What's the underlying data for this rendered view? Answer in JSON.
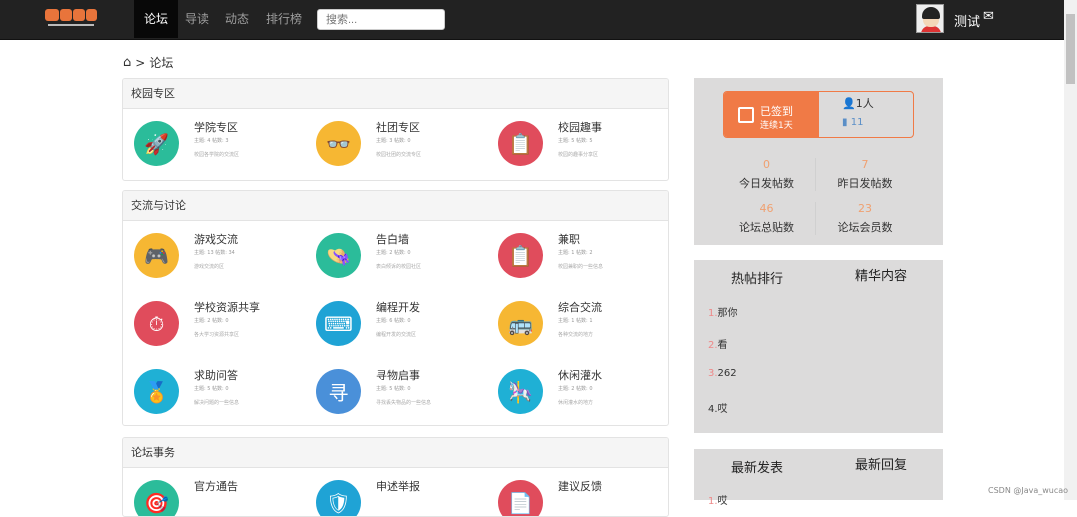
{
  "nav": {
    "items": [
      "论坛",
      "导读",
      "动态",
      "排行榜"
    ],
    "active": 0,
    "search_placeholder": "搜索...",
    "username": "测试"
  },
  "breadcrumb": {
    "current": "论坛"
  },
  "sections": [
    {
      "title": "校园专区",
      "items": [
        {
          "name": "学院专区",
          "meta": "主题: 4  帖数: 3",
          "desc": "校园各学院的交流区",
          "icon": "rocket-icon",
          "color": "#2bbc9a",
          "glyph": "🚀"
        },
        {
          "name": "社团专区",
          "meta": "主题: 3  帖数: 0",
          "desc": "校园社团的交流专区",
          "icon": "glasses-icon",
          "color": "#f6b733",
          "glyph": "👓"
        },
        {
          "name": "校园趣事",
          "meta": "主题: 5  帖数: 5",
          "desc": "校园的趣事分享区",
          "icon": "checklist-icon",
          "color": "#e04c5c",
          "glyph": "📋"
        }
      ]
    },
    {
      "title": "交流与讨论",
      "items": [
        {
          "name": "游戏交流",
          "meta": "主题: 13  帖数: 34",
          "desc": "游戏交流的区",
          "icon": "gamepad-icon",
          "color": "#f6b733",
          "glyph": "🎮"
        },
        {
          "name": "告白墙",
          "meta": "主题: 2  帖数: 0",
          "desc": "表白倾诉的校园社区",
          "icon": "hat-icon",
          "color": "#2bbc9a",
          "glyph": "👒"
        },
        {
          "name": "兼职",
          "meta": "主题: 1  帖数: 2",
          "desc": "校园兼职的一些信息",
          "icon": "clipboard-icon",
          "color": "#e04c5c",
          "glyph": "📋"
        },
        {
          "name": "学校资源共享",
          "meta": "主题: 2  帖数: 0",
          "desc": "各大学习资源共享区",
          "icon": "stopwatch-icon",
          "color": "#e04c5c",
          "glyph": "⏱"
        },
        {
          "name": "编程开发",
          "meta": "主题: 6  帖数: 0",
          "desc": "编程开发的交流区",
          "icon": "keyboard-icon",
          "color": "#1fa3d5",
          "glyph": "⌨"
        },
        {
          "name": "综合交流",
          "meta": "主题: 1  帖数: 1",
          "desc": "各种交流的地方",
          "icon": "bus-icon",
          "color": "#f6b733",
          "glyph": "🚌"
        },
        {
          "name": "求助问答",
          "meta": "主题: 5  帖数: 0",
          "desc": "解决问题的一些信息",
          "icon": "medal-icon",
          "color": "#1fb0d5",
          "glyph": "🏅"
        },
        {
          "name": "寻物启事",
          "meta": "主题: 5  帖数: 0",
          "desc": "寻找丢失物品的一些信息",
          "icon": "lost-found-icon",
          "color": "#4a90d9",
          "glyph": "寻"
        },
        {
          "name": "休闲灌水",
          "meta": "主题: 2  帖数: 0",
          "desc": "休闲灌水的地方",
          "icon": "mobile-icon",
          "color": "#1fb0d5",
          "glyph": "🎠"
        }
      ]
    },
    {
      "title": "论坛事务",
      "items": [
        {
          "name": "官方通告",
          "icon": "target-icon",
          "color": "#2bbc9a",
          "glyph": "🎯"
        },
        {
          "name": "申述举报",
          "icon": "shield-icon",
          "color": "#1fa3d5",
          "glyph": "🛡"
        },
        {
          "name": "建议反馈",
          "icon": "document-icon",
          "color": "#e04c5c",
          "glyph": "📄"
        }
      ]
    }
  ],
  "sidebar": {
    "signin": {
      "label": "已签到",
      "streak": "连续1天",
      "users": "1人",
      "count": "11"
    },
    "stats": [
      {
        "value": "0",
        "label": "今日发帖数"
      },
      {
        "value": "7",
        "label": "昨日发帖数"
      },
      {
        "value": "46",
        "label": "论坛总贴数"
      },
      {
        "value": "23",
        "label": "论坛会员数"
      }
    ],
    "hot": {
      "tabs": [
        "热帖排行",
        "精华内容"
      ],
      "items": [
        {
          "rank": "1.",
          "title": "那你"
        },
        {
          "rank": "2.",
          "title": "看"
        },
        {
          "rank": "3.",
          "title": "262"
        },
        {
          "rank": "4.",
          "title": "哎"
        }
      ]
    },
    "latest": {
      "tabs": [
        "最新发表",
        "最新回复"
      ],
      "items": [
        {
          "rank": "1.",
          "title": "哎"
        }
      ]
    }
  },
  "watermark": "CSDN @Java_wucao"
}
